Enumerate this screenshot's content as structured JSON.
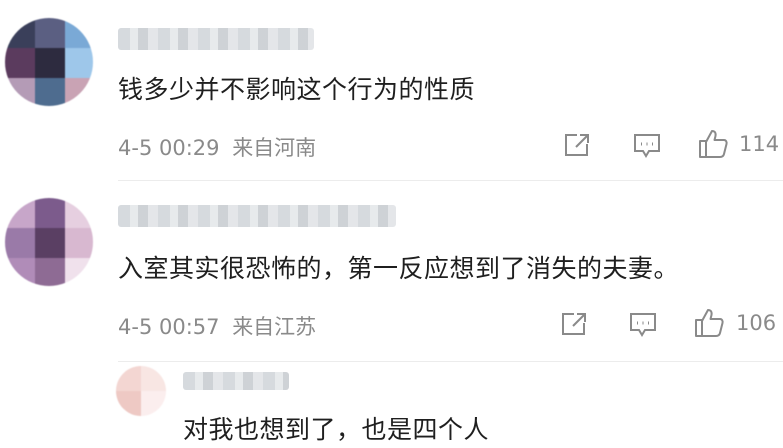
{
  "comments": [
    {
      "text": "钱多少并不影响这个行为的性质",
      "date": "4-5 00:29",
      "location": "来自河南",
      "likes": "114",
      "avatar_colors": [
        "#3a3f5a",
        "#7aa9d6",
        "#5b3b5e",
        "#9ec7ea",
        "#2d2b3f",
        "#b49bb6",
        "#4e6c8f",
        "#1f2233",
        "#c9a3b4"
      ]
    },
    {
      "text": "入室其实很恐怖的，第一反应想到了消失的夫妻。",
      "date": "4-5 00:57",
      "location": "来自江苏",
      "likes": "106",
      "avatar_colors": [
        "#c7a6c9",
        "#7c5b8c",
        "#e6cfe0",
        "#9a7aa8",
        "#5a3f63",
        "#d8b8d0",
        "#b08cb8",
        "#8e6b94",
        "#f0e1ec"
      ]
    }
  ],
  "reply": {
    "text": "对我也想到了，也是四个人",
    "avatar_colors": [
      "#f3d6d2",
      "#f8e6e3",
      "#eec9c4",
      "#fbeeee"
    ]
  },
  "icons": [
    "share-icon",
    "comment-icon",
    "like-icon"
  ]
}
